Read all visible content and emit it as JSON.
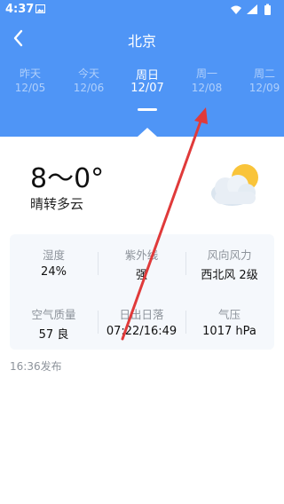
{
  "status_bar": {
    "time": "4:37"
  },
  "header": {
    "title": "北京",
    "back_icon": "chevron-left-icon"
  },
  "days": [
    {
      "name": "昨天",
      "date": "12/05"
    },
    {
      "name": "今天",
      "date": "12/06"
    },
    {
      "name": "周日",
      "date": "12/07"
    },
    {
      "name": "周一",
      "date": "12/08"
    },
    {
      "name": "周二",
      "date": "12/09"
    }
  ],
  "current": {
    "temperature": "8～0°",
    "condition": "晴转多云",
    "icon": "partly-cloudy-icon"
  },
  "details": [
    {
      "label": "湿度",
      "value": "24%"
    },
    {
      "label": "紫外线",
      "value": "强"
    },
    {
      "label": "风向风力",
      "value": "西北风 2级"
    },
    {
      "label": "空气质量",
      "value": "57 良"
    },
    {
      "label": "日出日落",
      "value": "07:22/16:49"
    },
    {
      "label": "气压",
      "value": "1017 hPa"
    }
  ],
  "publish_time": "16:36发布",
  "colors": {
    "header_bg": "#4f95f6",
    "card_bg": "#f5f8fc",
    "annotation_arrow": "#e03a3a"
  }
}
